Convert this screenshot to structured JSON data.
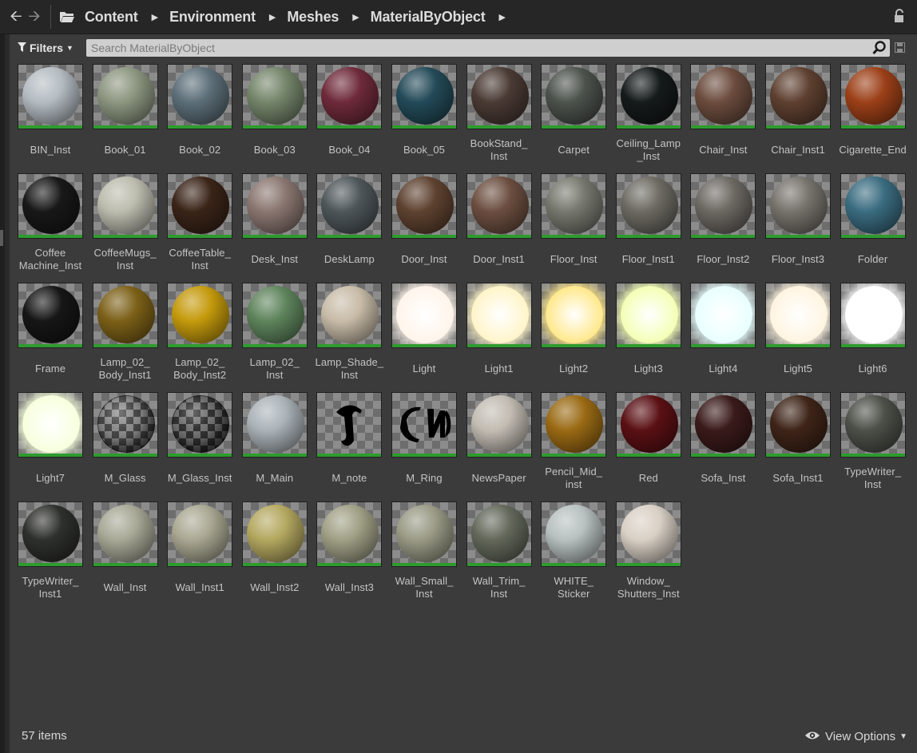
{
  "breadcrumb": {
    "items": [
      "Content",
      "Environment",
      "Meshes",
      "MaterialByObject"
    ]
  },
  "filters": {
    "label": "Filters"
  },
  "search": {
    "placeholder": "Search MaterialByObject",
    "value": ""
  },
  "colors": {
    "accent_bar": "#2e9b2e",
    "panel_bg": "#3b3b3b"
  },
  "assets": [
    {
      "label": "BIN_Inst",
      "color": "#b4bcc2",
      "type": "sphere"
    },
    {
      "label": "Book_01",
      "color": "#8c9680",
      "type": "sphere"
    },
    {
      "label": "Book_02",
      "color": "#5c6e78",
      "type": "sphere"
    },
    {
      "label": "Book_03",
      "color": "#74856a",
      "type": "sphere"
    },
    {
      "label": "Book_04",
      "color": "#6e2a3a",
      "type": "sphere"
    },
    {
      "label": "Book_05",
      "color": "#234a58",
      "type": "sphere"
    },
    {
      "label": "BookStand_\nInst",
      "color": "#4a3a34",
      "type": "sphere"
    },
    {
      "label": "Carpet",
      "color": "#4c524c",
      "type": "sphere"
    },
    {
      "label": "Ceiling_Lamp\n_Inst",
      "color": "#151a1a",
      "type": "sphere"
    },
    {
      "label": "Chair_Inst",
      "color": "#6c4c3e",
      "type": "sphere"
    },
    {
      "label": "Chair_Inst1",
      "color": "#5e4030",
      "type": "sphere"
    },
    {
      "label": "Cigarette_End",
      "color": "#9c4018",
      "type": "sphere"
    },
    {
      "label": "Coffee\nMachine_Inst",
      "color": "#181818",
      "type": "sphere"
    },
    {
      "label": "CoffeeMugs_\nInst",
      "color": "#bcbcae",
      "type": "sphere"
    },
    {
      "label": "CoffeeTable_\nInst",
      "color": "#3a2418",
      "type": "sphere"
    },
    {
      "label": "Desk_Inst",
      "color": "#8a7670",
      "type": "sphere"
    },
    {
      "label": "DeskLamp",
      "color": "#4e565a",
      "type": "sphere"
    },
    {
      "label": "Door_Inst",
      "color": "#5e4230",
      "type": "sphere"
    },
    {
      "label": "Door_Inst1",
      "color": "#6c4e40",
      "type": "sphere"
    },
    {
      "label": "Floor_Inst",
      "color": "#76786e",
      "type": "sphere"
    },
    {
      "label": "Floor_Inst1",
      "color": "#6c6a62",
      "type": "sphere"
    },
    {
      "label": "Floor_Inst2",
      "color": "#6c6862",
      "type": "sphere"
    },
    {
      "label": "Floor_Inst3",
      "color": "#76726c",
      "type": "sphere"
    },
    {
      "label": "Folder",
      "color": "#3a6c80",
      "type": "sphere"
    },
    {
      "label": "Frame",
      "color": "#161616",
      "type": "sphere"
    },
    {
      "label": "Lamp_02_\nBody_Inst1",
      "color": "#7c6018",
      "type": "sphere"
    },
    {
      "label": "Lamp_02_\nBody_Inst2",
      "color": "#c49a0c",
      "type": "sphere"
    },
    {
      "label": "Lamp_02_\nInst",
      "color": "#5e845c",
      "type": "sphere"
    },
    {
      "label": "Lamp_Shade_\nInst",
      "color": "#c8bca8",
      "type": "sphere"
    },
    {
      "label": "Light",
      "color": "#fff4ea",
      "type": "glow"
    },
    {
      "label": "Light1",
      "color": "#fff4c8",
      "type": "glow"
    },
    {
      "label": "Light2",
      "color": "#ffe88a",
      "type": "glow"
    },
    {
      "label": "Light3",
      "color": "#f4ffb4",
      "type": "glow"
    },
    {
      "label": "Light4",
      "color": "#e8ffff",
      "type": "glow"
    },
    {
      "label": "Light5",
      "color": "#fff4e0",
      "type": "glow"
    },
    {
      "label": "Light6",
      "color": "#ffffff",
      "type": "glow"
    },
    {
      "label": "Light7",
      "color": "#f6ffdc",
      "type": "glow"
    },
    {
      "label": "M_Glass",
      "color": "#6a6a6a",
      "type": "glass"
    },
    {
      "label": "M_Glass_Inst",
      "color": "#4a4a4a",
      "type": "glass"
    },
    {
      "label": "M_Main",
      "color": "#aab2b8",
      "type": "sphere"
    },
    {
      "label": "M_note",
      "color": "#000000",
      "type": "decal-note"
    },
    {
      "label": "M_Ring",
      "color": "#000000",
      "type": "decal-ring"
    },
    {
      "label": "NewsPaper",
      "color": "#c2bcb2",
      "type": "sphere"
    },
    {
      "label": "Pencil_Mid_\ninst",
      "color": "#9a6a14",
      "type": "sphere"
    },
    {
      "label": "Red",
      "color": "#5a1014",
      "type": "sphere"
    },
    {
      "label": "Sofa_Inst",
      "color": "#3a1a1a",
      "type": "sphere"
    },
    {
      "label": "Sofa_Inst1",
      "color": "#3e2418",
      "type": "sphere"
    },
    {
      "label": "TypeWriter_\nInst",
      "color": "#4c5048",
      "type": "sphere"
    },
    {
      "label": "TypeWriter_\nInst1",
      "color": "#2e302c",
      "type": "sphere"
    },
    {
      "label": "Wall_Inst",
      "color": "#a8a896",
      "type": "sphere"
    },
    {
      "label": "Wall_Inst1",
      "color": "#aaa892",
      "type": "sphere"
    },
    {
      "label": "Wall_Inst2",
      "color": "#b4a860",
      "type": "sphere"
    },
    {
      "label": "Wall_Inst3",
      "color": "#a0a086",
      "type": "sphere"
    },
    {
      "label": "Wall_Small_\nInst",
      "color": "#9a9a86",
      "type": "sphere"
    },
    {
      "label": "Wall_Trim_\nInst",
      "color": "#62685a",
      "type": "sphere"
    },
    {
      "label": "WHITE_\nSticker",
      "color": "#b8c0c0",
      "type": "sphere"
    },
    {
      "label": "Window_\nShutters_Inst",
      "color": "#d8d0c4",
      "type": "sphere"
    }
  ],
  "footer": {
    "item_count": "57 items",
    "view_options": "View Options"
  }
}
